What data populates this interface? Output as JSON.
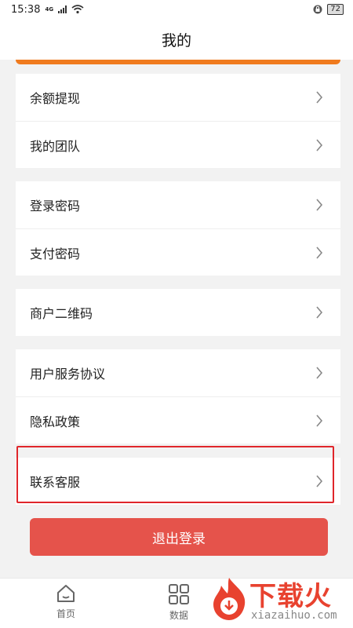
{
  "status_bar": {
    "time": "15:38",
    "network": "4G",
    "battery": "72"
  },
  "header": {
    "title": "我的"
  },
  "groups": [
    {
      "items": [
        {
          "label": "余额提现"
        },
        {
          "label": "我的团队"
        }
      ]
    },
    {
      "items": [
        {
          "label": "登录密码"
        },
        {
          "label": "支付密码"
        }
      ]
    },
    {
      "items": [
        {
          "label": "商户二维码"
        }
      ]
    },
    {
      "items": [
        {
          "label": "用户服务协议"
        },
        {
          "label": "隐私政策"
        }
      ]
    },
    {
      "items": [
        {
          "label": "联系客服"
        }
      ]
    }
  ],
  "logout_label": "退出登录",
  "tabbar": {
    "tabs": [
      {
        "label": "首页",
        "icon": "home-icon"
      },
      {
        "label": "数据",
        "icon": "grid-icon"
      }
    ]
  },
  "watermark": {
    "brand": "下载火",
    "url": "xiazaihuo.com"
  },
  "colors": {
    "accent": "#f07b1e",
    "logout": "#e5534b",
    "highlight": "#e0262b"
  }
}
